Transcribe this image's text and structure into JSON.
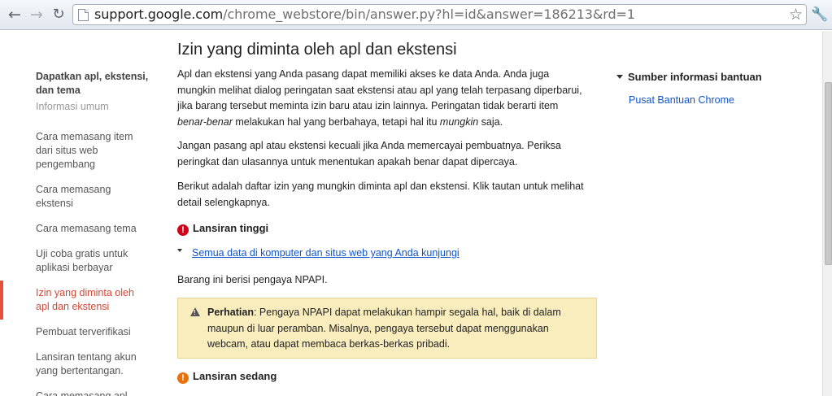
{
  "browser": {
    "url_host": "support.google.com",
    "url_path": "/chrome_webstore/bin/answer.py?hl=id&answer=186213&rd=1"
  },
  "sidebar": {
    "heading": "Dapatkan apl, ekstensi, dan tema",
    "subheading": "Informasi umum",
    "items": [
      {
        "label": "Cara memasang item dari situs web pengembang"
      },
      {
        "label": "Cara memasang ekstensi"
      },
      {
        "label": "Cara memasang tema"
      },
      {
        "label": "Uji coba gratis untuk aplikasi berbayar"
      },
      {
        "label": "Izin yang diminta oleh apl dan ekstensi"
      },
      {
        "label": "Pembuat terverifikasi"
      },
      {
        "label": "Lansiran tentang akun yang bertentangan."
      },
      {
        "label": "Cara memasang apl"
      }
    ]
  },
  "main": {
    "title": "Izin yang diminta oleh apl dan ekstensi",
    "para1_a": "Apl dan ekstensi yang Anda pasang dapat memiliki akses ke data Anda. Anda juga mungkin melihat dialog peringatan saat ekstensi atau apl yang telah terpasang diperbarui, jika barang tersebut meminta izin baru atau izin lainnya. Peringatan tidak berarti item ",
    "para1_em1": "benar-benar",
    "para1_b": " melakukan hal yang berbahaya, tetapi hal itu ",
    "para1_em2": "mungkin",
    "para1_c": " saja.",
    "para2": "Jangan pasang apl atau ekstensi kecuali jika Anda memercayai pembuatnya. Periksa peringkat dan ulasannya untuk menentukan apakah benar dapat dipercaya.",
    "para3": "Berikut adalah daftar izin yang mungkin diminta apl dan ekstensi. Klik tautan untuk melihat detail selengkapnya.",
    "severity_high": "Lansiran tinggi",
    "permission_link": "Semua data di komputer dan situs web yang Anda kunjungi",
    "npapi_note": "Barang ini berisi pengaya NPAPI.",
    "warning_label": "Perhatian",
    "warning_text": ": Pengaya NPAPI dapat melakukan hampir segala hal, baik di dalam maupun di luar peramban. Misalnya, pengaya tersebut dapat menggunakan webcam, atau dapat membaca berkas-berkas pribadi.",
    "severity_medium": "Lansiran sedang"
  },
  "right": {
    "heading": "Sumber informasi bantuan",
    "link": "Pusat Bantuan Chrome"
  }
}
